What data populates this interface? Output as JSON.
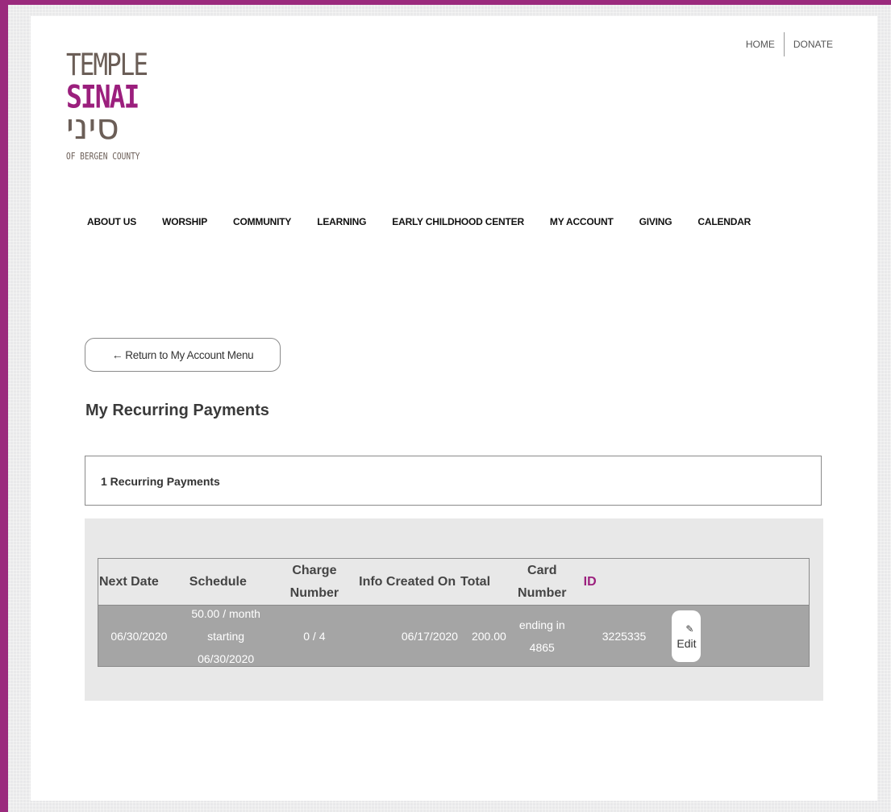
{
  "header": {
    "links": [
      "HOME",
      "DONATE"
    ],
    "logo": {
      "line1": "TEMPLE",
      "line2": "SINAI",
      "line3": "סיני",
      "line4": "OF BERGEN COUNTY"
    }
  },
  "nav": [
    "ABOUT US",
    "WORSHIP",
    "COMMUNITY",
    "LEARNING",
    "EARLY CHILDHOOD CENTER",
    "MY ACCOUNT",
    "GIVING",
    "CALENDAR"
  ],
  "return_button": {
    "arrow": "←",
    "label": "Return to My Account Menu"
  },
  "page_title": "My Recurring Payments",
  "count_label": "1 Recurring Payments",
  "table": {
    "headers": [
      "Next Date",
      "Schedule",
      "Charge Number",
      "Info Created On",
      "Total",
      "Card Number",
      "ID"
    ],
    "rows": [
      {
        "next_date": "06/30/2020",
        "schedule": "50.00 / month starting 06/30/2020",
        "charge_number": "0 / 4",
        "created_on": "06/17/2020",
        "total": "200.00",
        "card_number": "ending in 4865",
        "id": "3225335",
        "edit_icon": "pencil-icon",
        "edit_label": "Edit"
      }
    ]
  },
  "colors": {
    "brand": "#9b2a7d",
    "accent": "#9b1f7d",
    "row_bg": "#a5a5a5"
  }
}
